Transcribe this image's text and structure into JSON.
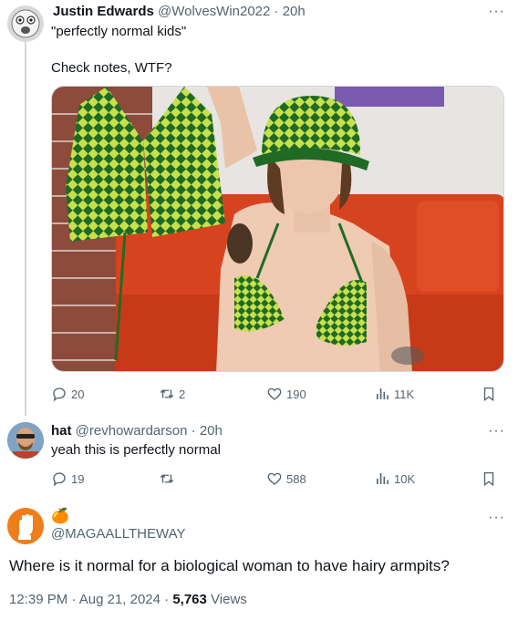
{
  "tweets": [
    {
      "name": "Justin Edwards",
      "handle": "@WolvesWin2022",
      "sep": "·",
      "time": "20h",
      "text_lines": [
        "\"perfectly normal kids\"",
        "Check notes, WTF?"
      ],
      "stats": {
        "replies": "20",
        "retweets": "2",
        "likes": "190",
        "views": "11K"
      }
    },
    {
      "name": "hat",
      "handle": "@revhowardarson",
      "sep": "·",
      "time": "20h",
      "text": "yeah this is perfectly normal",
      "stats": {
        "replies": "19",
        "retweets": "",
        "likes": "588",
        "views": "10K"
      }
    }
  ],
  "main_tweet": {
    "name_emoji": "🍊",
    "handle": "@MAGAALLTHEWAY",
    "text": "Where is it normal for a biological woman to have hairy armpits?",
    "time": "12:39 PM",
    "date": "Aug 21, 2024",
    "sep": "·",
    "views_count": "5,763",
    "views_label": "Views"
  },
  "icons": {
    "more": "more-icon",
    "reply": "reply-icon",
    "retweet": "retweet-icon",
    "like": "like-icon",
    "views": "views-icon",
    "bookmark": "bookmark-icon"
  },
  "colors": {
    "text": "#0f1419",
    "secondary": "#536471",
    "border": "#cfd9de",
    "avatar_orange": "#f07d1c"
  }
}
